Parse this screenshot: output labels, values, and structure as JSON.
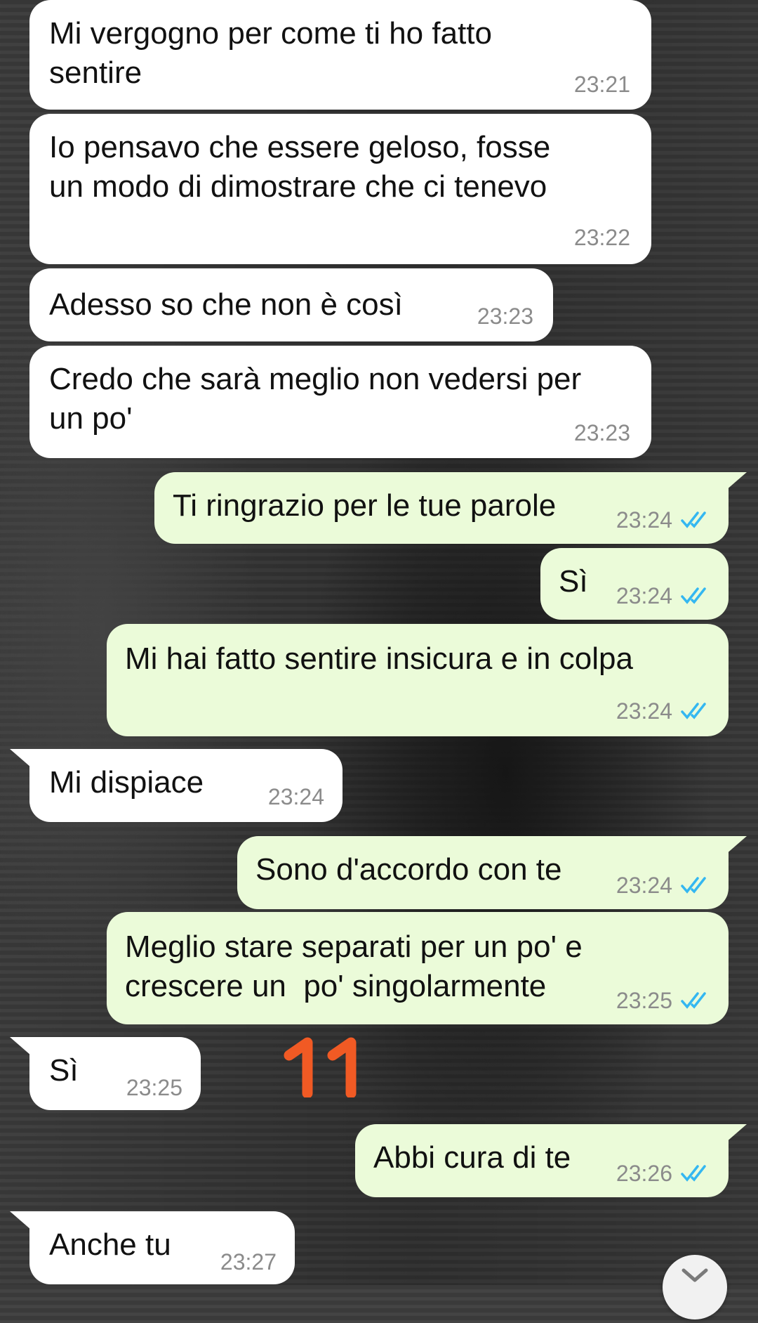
{
  "messages": [
    {
      "dir": "in",
      "lines": "Mi vergogno per come ti ho fatto\nsentire",
      "time": "23:21"
    },
    {
      "dir": "in",
      "lines": "Io pensavo che essere geloso, fosse\nun modo di dimostrare che ci tenevo",
      "time": "23:22"
    },
    {
      "dir": "in",
      "lines": "Adesso so che non è così",
      "time": "23:23"
    },
    {
      "dir": "in",
      "lines": "Credo che sarà meglio non vedersi per\nun po'",
      "time": "23:23"
    },
    {
      "dir": "out",
      "lines": "Ti ringrazio per le tue parole",
      "time": "23:24"
    },
    {
      "dir": "out",
      "lines": "Sì",
      "time": "23:24"
    },
    {
      "dir": "out",
      "lines": "Mi hai fatto sentire insicura e in colpa",
      "time": "23:24"
    },
    {
      "dir": "in",
      "lines": "Mi dispiace",
      "time": "23:24"
    },
    {
      "dir": "out",
      "lines": "Sono d'accordo con te",
      "time": "23:24"
    },
    {
      "dir": "out",
      "lines": "Meglio stare separati per un po' e\ncrescere un  po' singolarmente",
      "time": "23:25"
    },
    {
      "dir": "in",
      "lines": "Sì",
      "time": "23:25"
    },
    {
      "dir": "out",
      "lines": "Abbi cura di te",
      "time": "23:26"
    },
    {
      "dir": "in",
      "lines": "Anche tu",
      "time": "23:27"
    }
  ],
  "annotation": {
    "text": "11",
    "color": "#f15a24"
  },
  "colors": {
    "incoming": "#ffffff",
    "outgoing": "#ebfbd9",
    "read_ticks": "#34b7f1",
    "time": "#8b8b8b"
  },
  "scroll_button": {
    "icon": "chevron-down-icon"
  }
}
